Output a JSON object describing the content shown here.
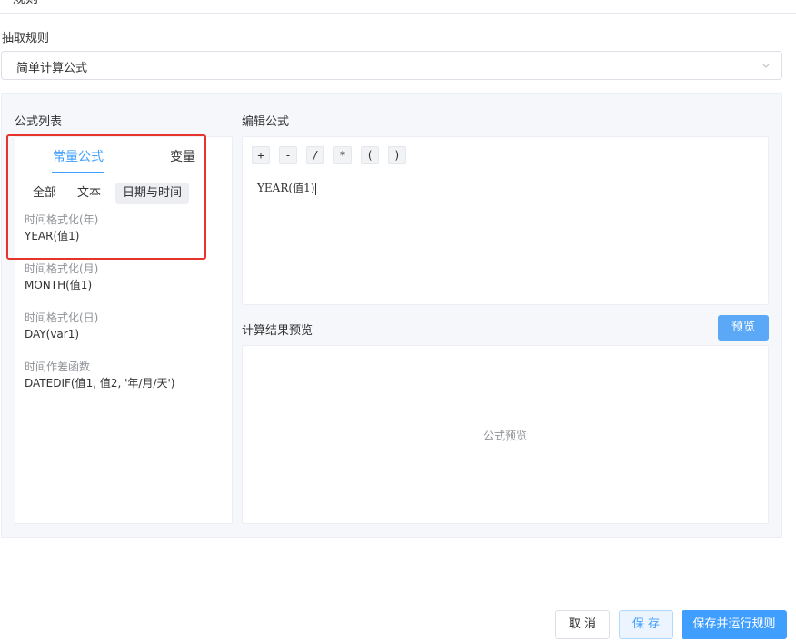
{
  "page": {
    "title": "规则"
  },
  "rule": {
    "label": "抽取规则",
    "selected": "简单计算公式"
  },
  "formula_list": {
    "title": "公式列表",
    "tabs": [
      {
        "label": "常量公式",
        "active": true
      },
      {
        "label": "变量",
        "active": false
      }
    ],
    "subtabs": [
      {
        "label": "全部"
      },
      {
        "label": "文本"
      },
      {
        "label": "日期与时间",
        "active": true
      }
    ],
    "items": [
      {
        "name": "时间格式化(年)",
        "expr": "YEAR(值1)"
      },
      {
        "name": "时间格式化(月)",
        "expr": "MONTH(值1)"
      },
      {
        "name": "时间格式化(日)",
        "expr": "DAY(var1)"
      },
      {
        "name": "时间作差函数",
        "expr": "DATEDIF(值1, 值2, '年/月/天')"
      }
    ]
  },
  "editor": {
    "title": "编辑公式",
    "operators": [
      "+",
      "-",
      "/",
      "*",
      "(",
      ")"
    ],
    "content": "YEAR(值1)"
  },
  "preview": {
    "title": "计算结果预览",
    "button_label": "预览",
    "placeholder": "公式预览"
  },
  "footer": {
    "cancel_label": "取 消",
    "save_label": "保 存",
    "save_run_label": "保存并运行规则"
  },
  "colors": {
    "accent": "#409eff",
    "highlight": "#e8322c",
    "panel_bg": "#f6f7fa"
  },
  "icons": {
    "select_arrow": "chevron-down-icon"
  }
}
